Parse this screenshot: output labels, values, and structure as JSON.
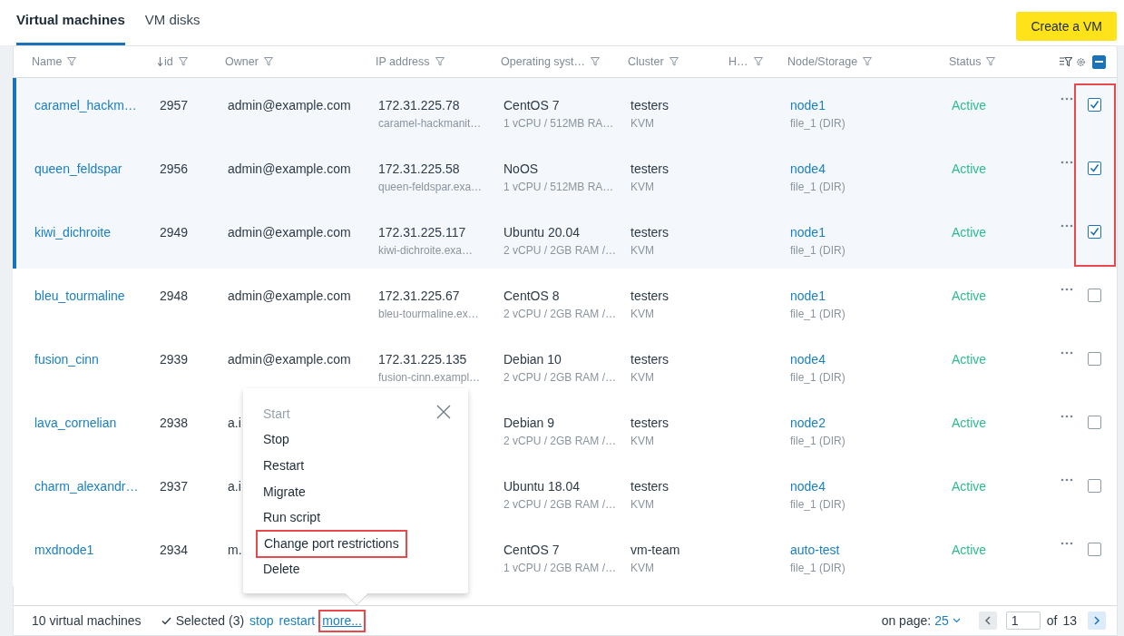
{
  "tabs": [
    {
      "label": "Virtual machines",
      "selected": true
    },
    {
      "label": "VM disks",
      "selected": false
    }
  ],
  "create_button": "Create a VM",
  "select_all": {
    "checked": true,
    "partial": true
  },
  "columns": [
    {
      "label": "Name",
      "sorted": false
    },
    {
      "label": "id",
      "sorted": true
    },
    {
      "label": "Owner",
      "sorted": false
    },
    {
      "label": "IP address",
      "sorted": false
    },
    {
      "label": "Operating syst…",
      "sorted": false
    },
    {
      "label": "Cluster",
      "sorted": false
    },
    {
      "label": "H…",
      "sorted": false
    },
    {
      "label": "Node/Storage",
      "sorted": false
    },
    {
      "label": "Status",
      "sorted": false
    }
  ],
  "rows": [
    {
      "name": "caramel_hackm…",
      "id": "2957",
      "owner": "admin@example.com",
      "ip": "172.31.225.78",
      "host": "caramel-hackmanit…",
      "os": "CentOS 7",
      "resources": "1 vCPU / 512MB RA…",
      "cluster": "testers",
      "virt": "KVM",
      "node": "node1",
      "storage": "file_1 (DIR)",
      "status": "Active",
      "checked": true
    },
    {
      "name": "queen_feldspar",
      "id": "2956",
      "owner": "admin@example.com",
      "ip": "172.31.225.58",
      "host": "queen-feldspar.exa…",
      "os": "NoOS",
      "resources": "1 vCPU / 512MB RA…",
      "cluster": "testers",
      "virt": "KVM",
      "node": "node4",
      "storage": "file_1 (DIR)",
      "status": "Active",
      "checked": true
    },
    {
      "name": "kiwi_dichroite",
      "id": "2949",
      "owner": "admin@example.com",
      "ip": "172.31.225.117",
      "host": "kiwi-dichroite.exa…",
      "os": "Ubuntu 20.04",
      "resources": "2 vCPU / 2GB RAM /…",
      "cluster": "testers",
      "virt": "KVM",
      "node": "node1",
      "storage": "file_1 (DIR)",
      "status": "Active",
      "checked": true
    },
    {
      "name": "bleu_tourmaline",
      "id": "2948",
      "owner": "admin@example.com",
      "ip": "172.31.225.67",
      "host": "bleu-tourmaline.ex…",
      "os": "CentOS 8",
      "resources": "2 vCPU / 2GB RAM /…",
      "cluster": "testers",
      "virt": "KVM",
      "node": "node1",
      "storage": "file_1 (DIR)",
      "status": "Active",
      "checked": false
    },
    {
      "name": "fusion_cinn",
      "id": "2939",
      "owner": "admin@example.com",
      "ip": "172.31.225.135",
      "host": "fusion-cinn.exampl…",
      "os": "Debian 10",
      "resources": "2 vCPU / 2GB RAM /…",
      "cluster": "testers",
      "virt": "KVM",
      "node": "node4",
      "storage": "file_1 (DIR)",
      "status": "Active",
      "checked": false
    },
    {
      "name": "lava_cornelian",
      "id": "2938",
      "owner": "a.i",
      "os": "Debian 9",
      "resources": "2 vCPU / 2GB RAM /…",
      "cluster": "testers",
      "virt": "KVM",
      "node": "node2",
      "storage": "file_1 (DIR)",
      "status": "Active",
      "checked": false
    },
    {
      "name": "charm_alexandr…",
      "id": "2937",
      "owner": "a.i",
      "os": "Ubuntu 18.04",
      "resources": "2 vCPU / 2GB RAM /…",
      "cluster": "testers",
      "virt": "KVM",
      "node": "node4",
      "storage": "file_1 (DIR)",
      "status": "Active",
      "checked": false
    },
    {
      "name": "mxdnode1",
      "id": "2934",
      "owner": "m.",
      "os": "CentOS 7",
      "resources": "1 vCPU / 2GB RAM /…",
      "cluster": "vm-team",
      "virt": "KVM",
      "node": "auto-test",
      "storage": "file_1 (DIR)",
      "status": "Active",
      "checked": false
    }
  ],
  "menu": {
    "items": [
      {
        "label": "Start",
        "disabled": true,
        "highlighted": false
      },
      {
        "label": "Stop",
        "disabled": false,
        "highlighted": false
      },
      {
        "label": "Restart",
        "disabled": false,
        "highlighted": false
      },
      {
        "label": "Migrate",
        "disabled": false,
        "highlighted": false
      },
      {
        "label": "Run script",
        "disabled": false,
        "highlighted": false
      },
      {
        "label": "Change port restrictions",
        "disabled": false,
        "highlighted": true
      },
      {
        "label": "Delete",
        "disabled": false,
        "highlighted": false
      }
    ]
  },
  "footer": {
    "count": "10 virtual machines",
    "selected": "Selected (3)",
    "actions": [
      {
        "label": "stop",
        "highlighted": false
      },
      {
        "label": "restart",
        "highlighted": false
      },
      {
        "label": "more...",
        "highlighted": true
      }
    ],
    "per_page_label": "on page:",
    "per_page": "25",
    "page": "1",
    "of_label": "of",
    "pages": "13"
  }
}
